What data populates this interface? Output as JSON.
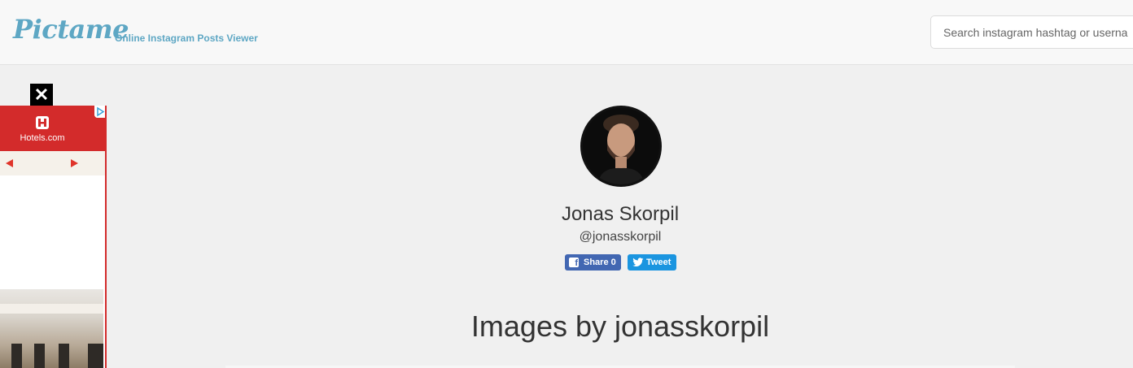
{
  "header": {
    "logo_text": "Pictame",
    "tagline": "Online Instagram Posts Viewer",
    "search_placeholder": "Search instagram hashtag or userna"
  },
  "ad": {
    "close_label": "✕",
    "brand_name": "Hotels.com",
    "brand_color": "#d32b2b"
  },
  "profile": {
    "name": "Jonas Skorpil",
    "handle": "@jonasskorpil",
    "share_label": "Share 0",
    "tweet_label": "Tweet"
  },
  "main": {
    "section_title": "Images by jonasskorpil"
  },
  "colors": {
    "accent": "#5ea7c4",
    "facebook": "#4267b2",
    "twitter": "#1b95e0",
    "background": "#f0f0f0"
  }
}
